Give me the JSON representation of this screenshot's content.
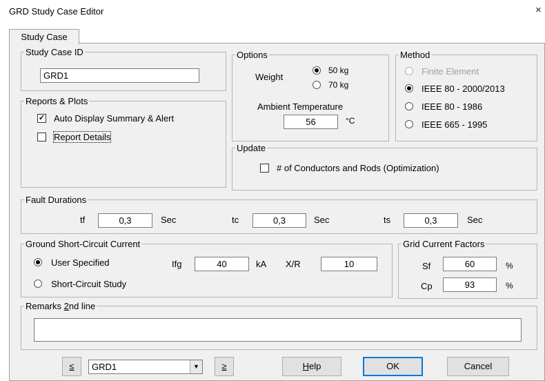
{
  "window": {
    "title": "GRD Study Case Editor",
    "close_glyph": "×"
  },
  "tabs": [
    {
      "label": "Study Case"
    }
  ],
  "study_case_id": {
    "legend": "Study Case ID",
    "value": "GRD1"
  },
  "options": {
    "legend": "Options",
    "weight_label": "Weight",
    "weight_options": [
      {
        "label": "50 kg",
        "selected": true
      },
      {
        "label": "70 kg",
        "selected": false
      }
    ],
    "ambient_label": "Ambient Temperature",
    "ambient_value": "56",
    "ambient_unit": "°C"
  },
  "method": {
    "legend": "Method",
    "items": [
      {
        "label": "Finite Element",
        "selected": false,
        "disabled": true
      },
      {
        "label": "IEEE 80 - 2000/2013",
        "selected": true,
        "disabled": false
      },
      {
        "label": "IEEE 80 - 1986",
        "selected": false,
        "disabled": false
      },
      {
        "label": "IEEE 665 - 1995",
        "selected": false,
        "disabled": false
      }
    ]
  },
  "reports": {
    "legend": "Reports & Plots",
    "auto_display": {
      "label": "Auto Display Summary & Alert",
      "checked": true
    },
    "report_details": {
      "label": "Report Details",
      "checked": false
    }
  },
  "update": {
    "legend": "Update",
    "conductors": {
      "label": "# of Conductors and Rods (Optimization)",
      "checked": false
    }
  },
  "fault_durations": {
    "legend": "Fault Durations",
    "tf": {
      "label": "tf",
      "value": "0,3",
      "unit": "Sec"
    },
    "tc": {
      "label": "tc",
      "value": "0,3",
      "unit": "Sec"
    },
    "ts": {
      "label": "ts",
      "value": "0,3",
      "unit": "Sec"
    }
  },
  "ground_current": {
    "legend": "Ground Short-Circuit Current",
    "user_specified": {
      "label": "User Specified",
      "selected": true
    },
    "short_circuit_study": {
      "label": "Short-Circuit Study",
      "selected": false
    },
    "ifg_label": "Ifg",
    "ifg_value": "40",
    "ifg_unit": "kA",
    "xr_label": "X/R",
    "xr_value": "10"
  },
  "grid_factors": {
    "legend": "Grid Current Factors",
    "sf": {
      "label": "Sf",
      "value": "60",
      "unit": "%"
    },
    "cp": {
      "label": "Cp",
      "value": "93",
      "unit": "%"
    }
  },
  "remarks": {
    "legend_prefix": "Remarks ",
    "legend_accel": "2",
    "legend_suffix": "nd line",
    "value": ""
  },
  "footer": {
    "prev_label": "≤",
    "next_label": "≥",
    "combo_value": "GRD1",
    "help_accel": "H",
    "help_rest": "elp",
    "ok_label": "OK",
    "cancel_label": "Cancel"
  }
}
